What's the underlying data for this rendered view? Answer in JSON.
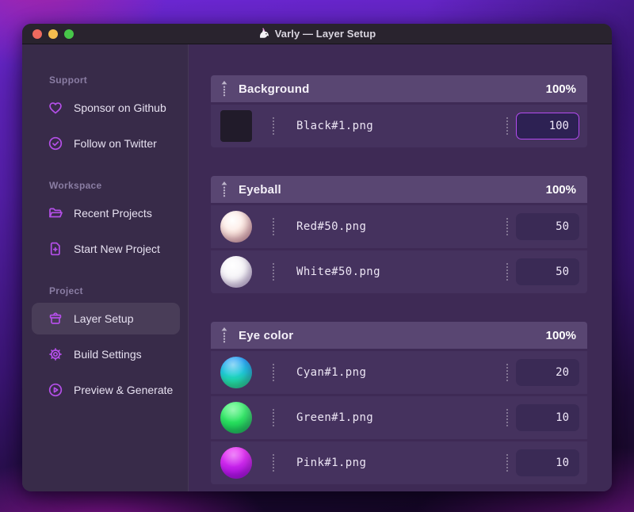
{
  "window": {
    "title": "Varly — Layer Setup"
  },
  "titlebar": {
    "traffic_lights": [
      "close-red",
      "minimize-yellow",
      "zoom-green"
    ],
    "app_icon": "unicorn-icon"
  },
  "colors": {
    "accent_icon": "#b44fe8",
    "focus_border": "#b44bf0",
    "traffic_red": "#ee6a5f",
    "traffic_yellow": "#f5bd4e",
    "traffic_green": "#47c649",
    "sidebar_bg": "#382b49",
    "main_bg": "#3e2a55",
    "row_bg": "#45325e",
    "header_bg": "#594672"
  },
  "sidebar": {
    "sections": [
      {
        "label": "Support",
        "items": [
          {
            "icon": "heart-icon",
            "label": "Sponsor on Github"
          },
          {
            "icon": "badge-check-icon",
            "label": "Follow on Twitter"
          }
        ]
      },
      {
        "label": "Workspace",
        "items": [
          {
            "icon": "folder-icon",
            "label": "Recent Projects"
          },
          {
            "icon": "file-plus-icon",
            "label": "Start New Project"
          }
        ]
      },
      {
        "label": "Project",
        "items": [
          {
            "icon": "archive-box-icon",
            "label": "Layer Setup",
            "selected": true
          },
          {
            "icon": "gear-icon",
            "label": "Build Settings"
          },
          {
            "icon": "play-circle-icon",
            "label": "Preview & Generate"
          }
        ]
      }
    ]
  },
  "main": {
    "groups": [
      {
        "name": "Background",
        "weight": "100%",
        "layers": [
          {
            "thumb": "black-swatch",
            "file": "Black#1.png",
            "value": "100",
            "focused": true
          }
        ]
      },
      {
        "name": "Eyeball",
        "weight": "100%",
        "layers": [
          {
            "thumb": "red-sphere",
            "file": "Red#50.png",
            "value": "50"
          },
          {
            "thumb": "white-sphere",
            "file": "White#50.png",
            "value": "50"
          }
        ]
      },
      {
        "name": "Eye color",
        "weight": "100%",
        "layers": [
          {
            "thumb": "cyan-sphere",
            "file": "Cyan#1.png",
            "value": "20"
          },
          {
            "thumb": "green-sphere",
            "file": "Green#1.png",
            "value": "10"
          },
          {
            "thumb": "pink-sphere",
            "file": "Pink#1.png",
            "value": "10"
          }
        ]
      }
    ]
  }
}
